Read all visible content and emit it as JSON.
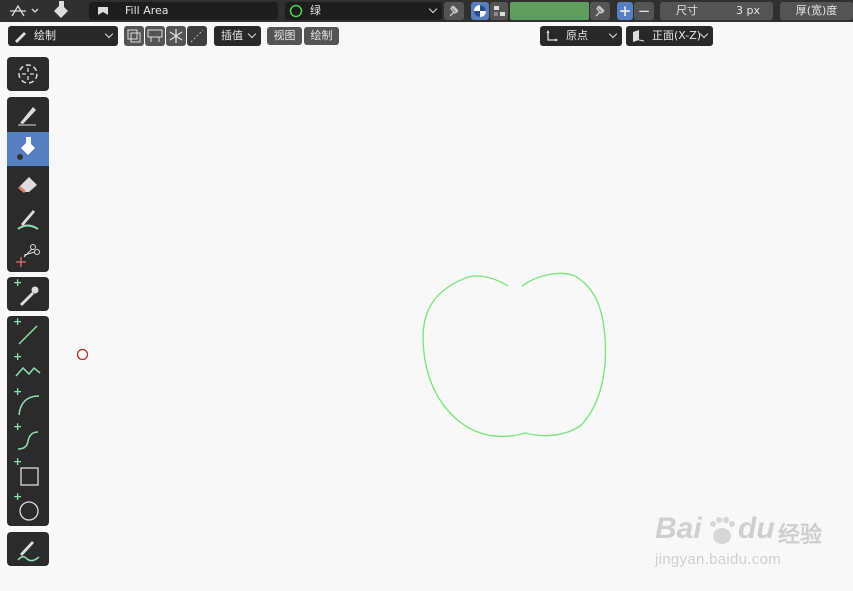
{
  "header": {
    "brush_name": "Fill Area",
    "material_name": "绿",
    "color_swatch": "#5e9d5e",
    "size_label": "尺寸",
    "size_value": "3 px",
    "thickness_label": "厚(宽)度"
  },
  "toolbar2": {
    "mode": "绘制",
    "interpolate": "插值",
    "menu_view": "视图",
    "menu_draw": "绘制",
    "pivot": "原点",
    "view_orient": "正面(X-Z)"
  },
  "tools": [
    {
      "name": "cursor-tool"
    },
    {
      "name": "draw-tool"
    },
    {
      "name": "fill-tool",
      "active": true
    },
    {
      "name": "erase-tool"
    },
    {
      "name": "tint-tool"
    },
    {
      "name": "cutter-tool"
    },
    {
      "name": "eyedropper-tool"
    },
    {
      "name": "line-tool"
    },
    {
      "name": "polyline-tool"
    },
    {
      "name": "arc-tool"
    },
    {
      "name": "curve-tool"
    },
    {
      "name": "box-tool"
    },
    {
      "name": "circle-tool"
    },
    {
      "name": "annotate-tool"
    }
  ],
  "watermark": {
    "brand": "Bai",
    "brand2": "du",
    "cn": "经验",
    "url": "jingyan.baidu.com"
  },
  "colors": {
    "stroke": "#7ee67e",
    "accent": "#5680c2",
    "cursor": "#b03030"
  }
}
